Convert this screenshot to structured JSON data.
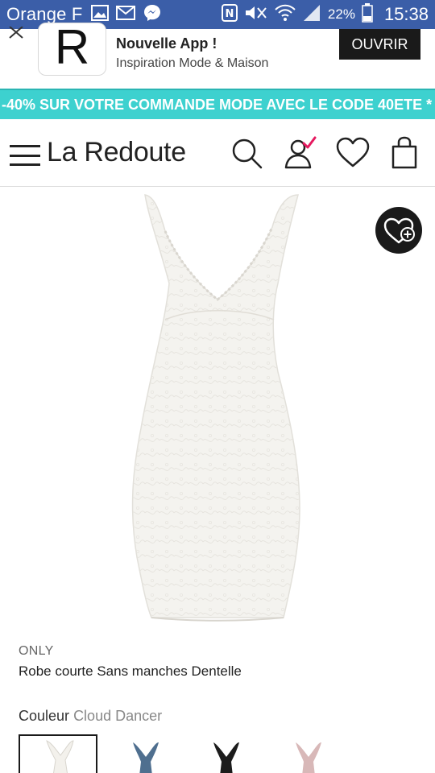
{
  "status_bar": {
    "carrier": "Orange F",
    "battery_percent": "22%",
    "time": "15:38",
    "icons": [
      "gallery-icon",
      "mail-icon",
      "messenger-icon",
      "nfc-icon",
      "mute-icon",
      "wifi-icon",
      "signal-icon",
      "battery-icon"
    ]
  },
  "app_banner": {
    "icon_letter": "R",
    "title": "Nouvelle App !",
    "subtitle": "Inspiration Mode & Maison",
    "open_label": "OUVRIR"
  },
  "promo": {
    "text": "-40% SUR VOTRE COMMANDE MODE AVEC LE CODE 40ETE *"
  },
  "header": {
    "logo": "La Redoute",
    "icons": [
      "menu-icon",
      "search-icon",
      "account-icon",
      "wishlist-icon",
      "bag-icon"
    ]
  },
  "product": {
    "brand": "ONLY",
    "title": "Robe courte Sans manches Dentelle",
    "color_label": "Couleur",
    "color_value": "Cloud Dancer",
    "image_icon": "white-lace-dress",
    "swatches": [
      {
        "name": "Cloud Dancer",
        "color": "#f3f1ec",
        "selected": true
      },
      {
        "name": "denim",
        "color": "#4f6f8f",
        "selected": false
      },
      {
        "name": "noir",
        "color": "#1c1c1c",
        "selected": false
      },
      {
        "name": "rose",
        "color": "#d8b8b8",
        "selected": false
      }
    ]
  },
  "colors": {
    "status_bar": "#3b5ea8",
    "promo": "#3dd1cf",
    "accent_check": "#e5195f"
  }
}
